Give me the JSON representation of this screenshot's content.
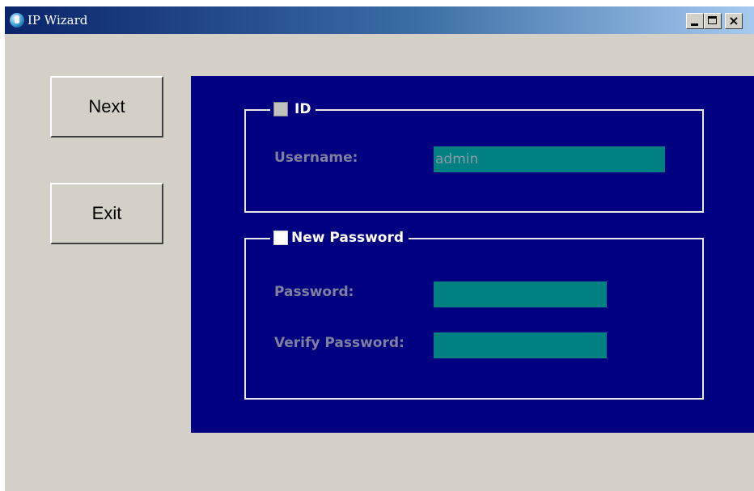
{
  "window": {
    "title": "IP Wizard",
    "controls": {
      "minimize_icon": "minimize-icon",
      "maximize_icon": "maximize-icon",
      "close_glyph": "×"
    }
  },
  "buttons": {
    "next_label": "Next",
    "exit_label": "Exit"
  },
  "id_group": {
    "legend": "ID",
    "checked": false,
    "username_label": "Username:",
    "username_value": "admin"
  },
  "password_group": {
    "legend": "New Password",
    "checked": false,
    "password_label": "Password:",
    "password_value": "",
    "verify_label": "Verify Password:",
    "verify_value": ""
  },
  "colors": {
    "panel": "#000080",
    "field": "#008080",
    "disabled_text": "#7f7f9f",
    "dialog": "#d4d0c8"
  }
}
